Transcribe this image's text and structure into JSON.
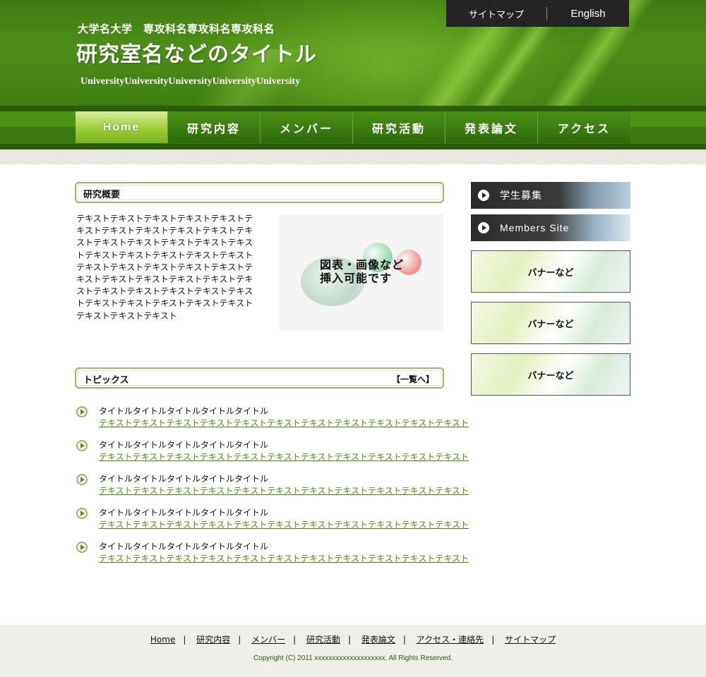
{
  "header": {
    "university_line": "大学名大学　専攻科名専攻科名専攻科名",
    "lab_title": "研究室名などのタイトル",
    "university_en": "UniversityUniversityUniversityUniversityUniversity",
    "top_links": {
      "sitemap": "サイトマップ",
      "english": "English"
    }
  },
  "nav": {
    "items": [
      {
        "label": "Home",
        "active": true
      },
      {
        "label": "研究内容",
        "active": false
      },
      {
        "label": "メンバー",
        "active": false
      },
      {
        "label": "研究活動",
        "active": false
      },
      {
        "label": "発表論文",
        "active": false
      },
      {
        "label": "アクセス",
        "active": false
      }
    ]
  },
  "overview": {
    "heading": "研究概要",
    "body": "テキストテキストテキストテキストテキストテキストテキストテキストテキストテキストテキストテキストテキストテキストテキストテキストテキストテキストテキストテキストテキストテキストテキストテキストテキストテキストテキストテキストテキストテキストテキストテキストテキストテキストテキストテキストテキストテキストテキストテキストテキストテキストテキストテキストテキスト",
    "figure_label_line1": "図表・画像など",
    "figure_label_line2": "挿入可能です"
  },
  "topics": {
    "heading": "トピックス",
    "more_link": "【一覧へ】",
    "items": [
      {
        "title": "タイトルタイトルタイトルタイトルタイトル",
        "text": "テキストテキストテキストテキストテキストテキストテキストテキストテキストテキストテキスト"
      },
      {
        "title": "タイトルタイトルタイトルタイトルタイトル",
        "text": "テキストテキストテキストテキストテキストテキストテキストテキストテキストテキストテキスト"
      },
      {
        "title": "タイトルタイトルタイトルタイトルタイトル",
        "text": "テキストテキストテキストテキストテキストテキストテキストテキストテキストテキストテキスト"
      },
      {
        "title": "タイトルタイトルタイトルタイトルタイトル",
        "text": "テキストテキストテキストテキストテキストテキストテキストテキストテキストテキストテキスト"
      },
      {
        "title": "タイトルタイトルタイトルタイトルタイトル",
        "text": "テキストテキストテキストテキストテキストテキストテキストテキストテキストテキストテキスト"
      }
    ]
  },
  "sidebar": {
    "recruit_label": "学生募集",
    "members_label": "Members Site",
    "banners": [
      "バナーなど",
      "バナーなど",
      "バナーなど"
    ]
  },
  "footer": {
    "links": [
      "Home",
      "研究内容",
      "メンバー",
      "研究活動",
      "発表論文",
      "アクセス・連絡先",
      "サイトマップ"
    ],
    "separator": "|",
    "copyright": "Copyright (C) 2011 xxxxxxxxxxxxxxxxxxxx. All Rights Reserved."
  },
  "colors": {
    "header_green": "#4d8f18",
    "nav_active": "#9ccd3a",
    "accent_link": "#4b8a10",
    "footer_bg": "#efeee8"
  }
}
